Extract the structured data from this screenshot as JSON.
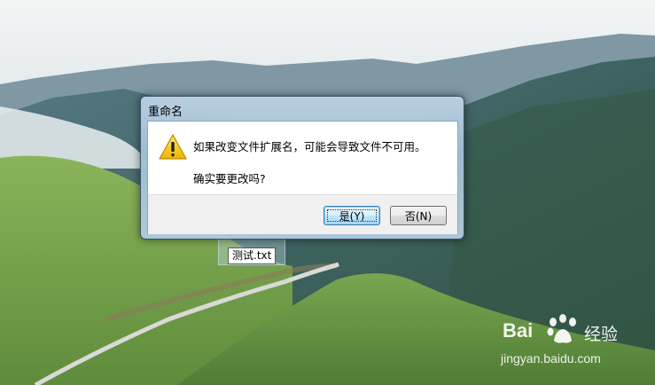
{
  "dialog": {
    "title": "重命名",
    "icon": "warning-triangle-icon",
    "message_line1": "如果改变文件扩展名，可能会导致文件不可用。",
    "message_line2": "确实要更改吗?",
    "yes_label": "是(Y)",
    "no_label": "否(N)"
  },
  "desktop": {
    "file_name": "测试.txt"
  },
  "watermark": {
    "brand": "Bai",
    "brand_suffix": "经验",
    "url": "jingyan.baidu.com"
  },
  "colors": {
    "dialog_frame": "#a0bed4",
    "default_button": "#3c7fb1",
    "warning_yellow": "#f5c400"
  }
}
